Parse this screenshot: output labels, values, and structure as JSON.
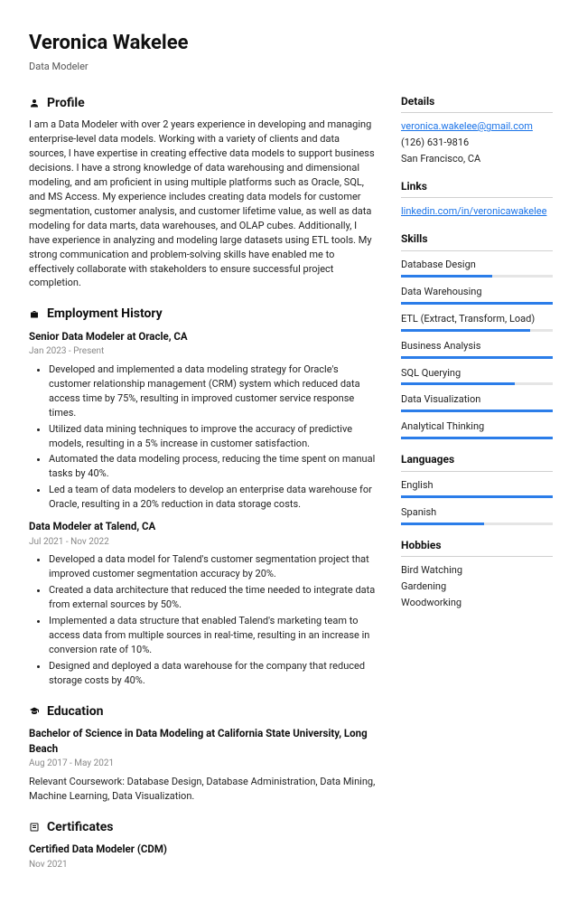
{
  "header": {
    "name": "Veronica Wakelee",
    "title": "Data Modeler"
  },
  "profile": {
    "heading": "Profile",
    "text": "I am a Data Modeler with over 2 years experience in developing and managing enterprise-level data models. Working with a variety of clients and data sources, I have expertise in creating effective data models to support business decisions. I have a strong knowledge of data warehousing and dimensional modeling, and am proficient in using multiple platforms such as Oracle, SQL, and MS Access. My experience includes creating data models for customer segmentation, customer analysis, and customer lifetime value, as well as data modeling for data marts, data warehouses, and OLAP cubes. Additionally, I have experience in analyzing and modeling large datasets using ETL tools. My strong communication and problem-solving skills have enabled me to effectively collaborate with stakeholders to ensure successful project completion."
  },
  "employment": {
    "heading": "Employment History",
    "jobs": [
      {
        "title": "Senior Data Modeler at Oracle, CA",
        "dates": "Jan 2023 - Present",
        "bullets": [
          "Developed and implemented a data modeling strategy for Oracle's customer relationship management (CRM) system which reduced data access time by 75%, resulting in improved customer service response times.",
          "Utilized data mining techniques to improve the accuracy of predictive models, resulting in a 5% increase in customer satisfaction.",
          "Automated the data modeling process, reducing the time spent on manual tasks by 40%.",
          "Led a team of data modelers to develop an enterprise data warehouse for Oracle, resulting in a 20% reduction in data storage costs."
        ]
      },
      {
        "title": "Data Modeler at Talend, CA",
        "dates": "Jul 2021 - Nov 2022",
        "bullets": [
          "Developed a data model for Talend's customer segmentation project that improved customer segmentation accuracy by 20%.",
          "Created a data architecture that reduced the time needed to integrate data from external sources by 50%.",
          "Implemented a data structure that enabled Talend's marketing team to access data from multiple sources in real-time, resulting in an increase in conversion rate of 10%.",
          "Designed and deployed a data warehouse for the company that reduced storage costs by 40%."
        ]
      }
    ]
  },
  "education": {
    "heading": "Education",
    "degree": "Bachelor of Science in Data Modeling at California State University, Long Beach",
    "dates": "Aug 2017 - May 2021",
    "desc": "Relevant Coursework: Database Design, Database Administration, Data Mining, Machine Learning, Data Visualization."
  },
  "certificates": {
    "heading": "Certificates",
    "title": "Certified Data Modeler (CDM)",
    "dates": "Nov 2021"
  },
  "details": {
    "heading": "Details",
    "email": "veronica.wakelee@gmail.com",
    "phone": "(126) 631-9816",
    "location": "San Francisco, CA"
  },
  "links": {
    "heading": "Links",
    "url": "linkedin.com/in/veronicawakelee"
  },
  "skills": {
    "heading": "Skills",
    "items": [
      {
        "label": "Database Design",
        "pct": 60
      },
      {
        "label": "Data Warehousing",
        "pct": 100
      },
      {
        "label": "ETL (Extract, Transform, Load)",
        "pct": 85
      },
      {
        "label": "Business Analysis",
        "pct": 100
      },
      {
        "label": "SQL Querying",
        "pct": 75
      },
      {
        "label": "Data Visualization",
        "pct": 100
      },
      {
        "label": "Analytical Thinking",
        "pct": 100
      }
    ]
  },
  "languages": {
    "heading": "Languages",
    "items": [
      {
        "label": "English",
        "pct": 100
      },
      {
        "label": "Spanish",
        "pct": 55
      }
    ]
  },
  "hobbies": {
    "heading": "Hobbies",
    "items": [
      "Bird Watching",
      "Gardening",
      "Woodworking"
    ]
  }
}
